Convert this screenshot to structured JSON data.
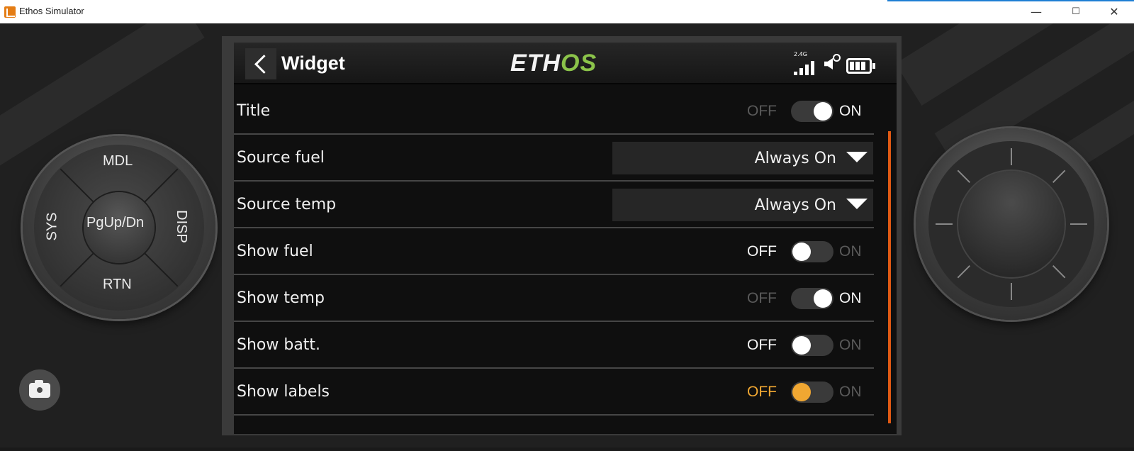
{
  "window": {
    "title": "Ethos Simulator",
    "minimize": "—",
    "maximize": "☐",
    "close": "✕"
  },
  "dpad": {
    "top": "MDL",
    "left": "SYS",
    "right": "DISP",
    "bottom": "RTN",
    "center": "PgUp/Dn"
  },
  "header": {
    "title": "Widget",
    "logo_part1": "ETH",
    "logo_part2": "OS",
    "band": "2.4G"
  },
  "rows": [
    {
      "label": "Title",
      "type": "toggle",
      "off_label": "OFF",
      "on_label": "ON",
      "state": "on"
    },
    {
      "label": "Source fuel",
      "type": "dropdown",
      "value": "Always On"
    },
    {
      "label": "Source temp",
      "type": "dropdown",
      "value": "Always On"
    },
    {
      "label": "Show fuel",
      "type": "toggle",
      "off_label": "OFF",
      "on_label": "ON",
      "state": "off"
    },
    {
      "label": "Show temp",
      "type": "toggle",
      "off_label": "OFF",
      "on_label": "ON",
      "state": "on"
    },
    {
      "label": "Show batt.",
      "type": "toggle",
      "off_label": "OFF",
      "on_label": "ON",
      "state": "off"
    },
    {
      "label": "Show labels",
      "type": "toggle",
      "off_label": "OFF",
      "on_label": "ON",
      "state": "off",
      "focused": true
    }
  ],
  "colors": {
    "accent_orange": "#f0a732",
    "scrollbar": "#e05a14",
    "logo_green": "#8bc34a"
  },
  "icons": [
    "back-arrow-icon",
    "signal-icon",
    "speaker-muted-icon",
    "battery-icon",
    "camera-icon"
  ]
}
